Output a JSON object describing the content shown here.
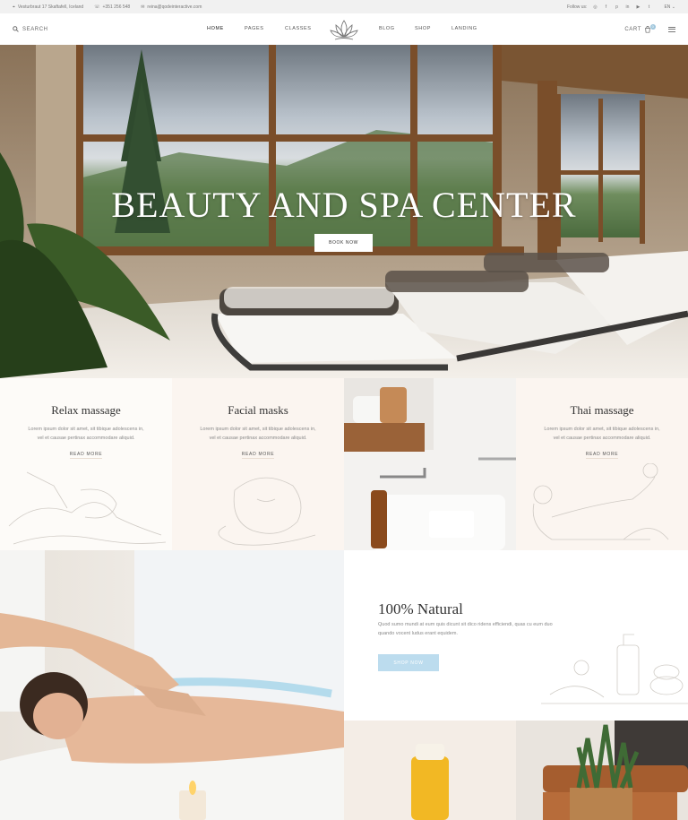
{
  "topbar": {
    "address": "Vesturbraut 17 Skaftafell, Iceland",
    "phone": "+351 256 548",
    "email": "reina@qodeinteractive.com",
    "follow": "Follow us:",
    "language": "EN"
  },
  "nav": {
    "search": "SEARCH",
    "items": [
      "HOME",
      "PAGES",
      "CLASSES",
      "BLOG",
      "SHOP",
      "LANDING"
    ],
    "cart": "CART",
    "cart_count": "0"
  },
  "hero": {
    "title": "BEAUTY AND SPA CENTER",
    "button": "BOOK NOW"
  },
  "cards": [
    {
      "title": "Relax massage",
      "text": "Lorem ipsum dolor sit amet, sit tibique adolescens in, vel et causae pertinax accommodare aliquid.",
      "link": "READ MORE"
    },
    {
      "title": "Facial masks",
      "text": "Lorem ipsum dolor sit amet, sit tibique adolescens in, vel et causae pertinax accommodare aliquid.",
      "link": "READ MORE"
    },
    {
      "title": "Thai massage",
      "text": "Lorem ipsum dolor sit amet, sit tibique adolescens in, vel et causae pertinax accommodare aliquid.",
      "link": "READ MORE"
    }
  ],
  "natural": {
    "title": "100% Natural",
    "text": "Quod sumo mundi at eum quis dicunt sit dico ridens efficiendi, quas cu eum duo quando vocent ludus erant equidem.",
    "button": "SHOP NOW"
  },
  "colors": {
    "accent_blue": "#bcdcee",
    "card_bg": "#fbf5f0",
    "wood": "#6b4a2b"
  }
}
